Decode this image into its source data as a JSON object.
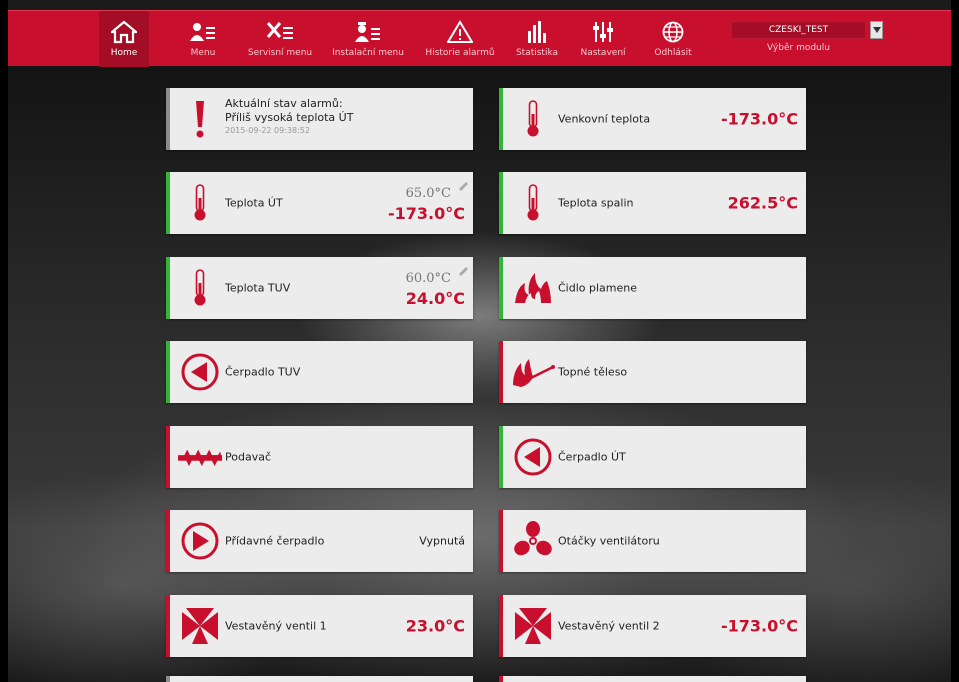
{
  "nav": {
    "items": [
      {
        "id": "home",
        "label": "Home",
        "icon": "home-icon"
      },
      {
        "id": "menu",
        "label": "Menu",
        "icon": "user-menu-icon"
      },
      {
        "id": "service",
        "label": "Servisní menu",
        "icon": "tools-icon"
      },
      {
        "id": "install",
        "label": "Instalační menu",
        "icon": "installer-icon"
      },
      {
        "id": "alarms",
        "label": "Historie alarmů",
        "icon": "warning-icon"
      },
      {
        "id": "stats",
        "label": "Statistika",
        "icon": "bar-chart-icon"
      },
      {
        "id": "settings",
        "label": "Nastavení",
        "icon": "sliders-icon"
      },
      {
        "id": "logout",
        "label": "Odhlásit",
        "icon": "globe-icon"
      }
    ],
    "module": {
      "selected": "CZESKI_TEST",
      "label": "Výběr modulu"
    }
  },
  "tiles": {
    "alarm": {
      "title": "Aktuální stav alarmů:",
      "text": "Příliš vysoká teplota ÚT",
      "time": "2015-09-22 09:38:52"
    },
    "outdoor": {
      "label": "Venkovní teplota",
      "value": "-173.0°C"
    },
    "ut": {
      "label": "Teplota ÚT",
      "setpoint": "65.0°C",
      "current": "-173.0°C"
    },
    "flue": {
      "label": "Teplota spalin",
      "value": "262.5°C"
    },
    "tuv": {
      "label": "Teplota TUV",
      "setpoint": "60.0°C",
      "current": "24.0°C"
    },
    "flame": {
      "label": "Čidlo plamene"
    },
    "pump_tuv": {
      "label": "Čerpadlo TUV"
    },
    "heater": {
      "label": "Topné těleso"
    },
    "feeder": {
      "label": "Podavač"
    },
    "pump_ut": {
      "label": "Čerpadlo ÚT"
    },
    "extra_pump": {
      "label": "Přídavné čerpadlo",
      "state": "Vypnutá"
    },
    "fan": {
      "label": "Otáčky ventilátoru"
    },
    "valve1": {
      "label": "Vestavěný ventil 1",
      "value": "23.0°C"
    },
    "valve2": {
      "label": "Vestavěný ventil 2",
      "value": "-173.0°C"
    }
  },
  "colors": {
    "accent": "#c8102e",
    "on": "#35b535",
    "off": "#c8102e",
    "tile": "#ececec"
  }
}
